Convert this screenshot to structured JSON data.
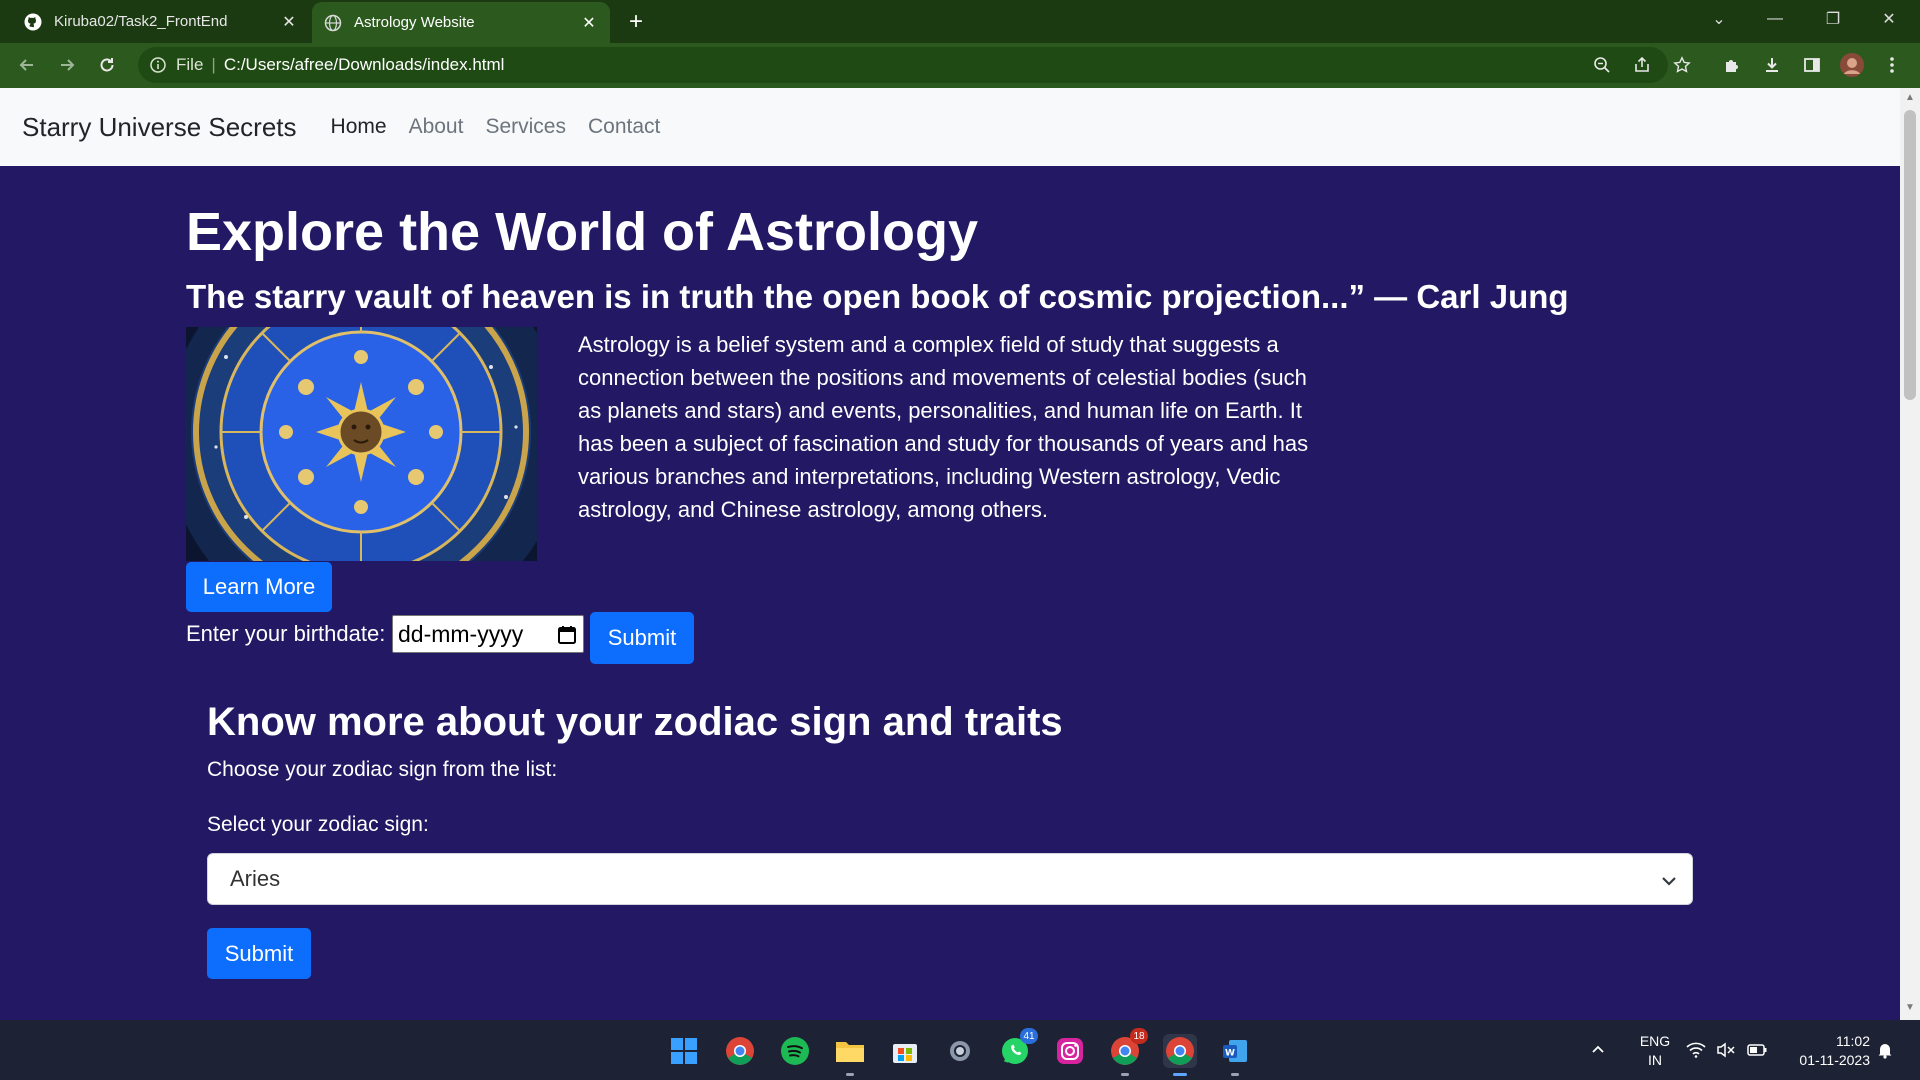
{
  "browser": {
    "tabs": [
      {
        "title": "Kiruba02/Task2_FrontEnd",
        "active": false
      },
      {
        "title": "Astrology Website",
        "active": true
      }
    ],
    "address": {
      "scheme_label": "File",
      "url": "C:/Users/afree/Downloads/index.html"
    }
  },
  "navbar": {
    "brand": "Starry Universe Secrets",
    "links": [
      "Home",
      "About",
      "Services",
      "Contact"
    ]
  },
  "hero": {
    "title": "Explore the World of Astrology",
    "quote": "The starry vault of heaven is in truth the open book of cosmic projection...” — Carl Jung",
    "description": "Astrology is a belief system and a complex field of study that suggests a connection between the positions and movements of celestial bodies (such as planets and stars) and events, personalities, and human life on Earth. It has been a subject of fascination and study for thousands of years and has various branches and interpretations, including Western astrology, Vedic astrology, and Chinese astrology, among others.",
    "learn_more": "Learn More"
  },
  "birthdate": {
    "label": "Enter your birthdate:",
    "placeholder": "dd-mm-yyyy",
    "submit": "Submit"
  },
  "zodiac": {
    "title": "Know more about your zodiac sign and traits",
    "subtitle": "Choose your zodiac sign from the list:",
    "select_label": "Select your zodiac sign:",
    "selected": "Aries",
    "submit": "Submit"
  },
  "taskbar": {
    "badges": {
      "whatsapp": "41",
      "chrome": "18"
    },
    "language": {
      "line1": "ENG",
      "line2": "IN"
    },
    "clock": {
      "time": "11:02",
      "date": "01-11-2023"
    }
  },
  "colors": {
    "page_background": "#231864",
    "button": "#0d6efd",
    "tab_bar": "#1c3a12",
    "toolbar": "#2c5a1e",
    "taskbar": "#1d2335"
  }
}
